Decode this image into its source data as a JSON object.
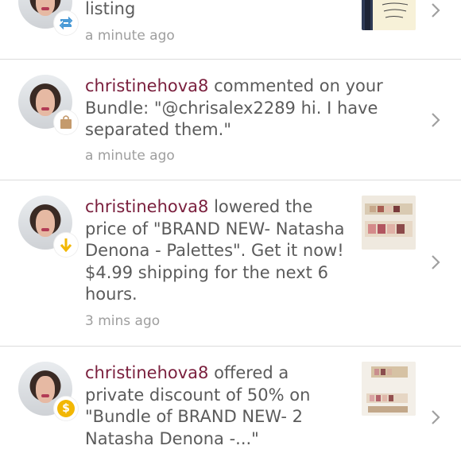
{
  "items": [
    {
      "message": "listing",
      "time": "a minute ago",
      "badge_icon": "repost-icon",
      "badge_color": "#4a9ad6"
    },
    {
      "username": "christinehova8",
      "message": " commented on your Bundle: \"@chrisalex2289 hi. I have separated them.\"",
      "time": "a minute ago",
      "badge_icon": "shopping-bag-icon",
      "badge_color": "#c49a6c"
    },
    {
      "username": "christinehova8",
      "message": " lowered the price of \"BRAND NEW- Natasha Denona - Palettes\". Get it now! $4.99 shipping for the next 6 hours.",
      "time": "3 mins ago",
      "badge_icon": "arrow-down-icon",
      "badge_color": "#f2b705"
    },
    {
      "username": "christinehova8",
      "message": " offered a private discount of 50% on \"Bundle of BRAND NEW- 2 Natasha Denona -...\"",
      "time": "",
      "badge_icon": "dollar-icon",
      "badge_color": "#f2b705"
    }
  ],
  "colors": {
    "username": "#7a1f3d",
    "divider": "#dcdcdc",
    "time": "#9e9e9e"
  }
}
